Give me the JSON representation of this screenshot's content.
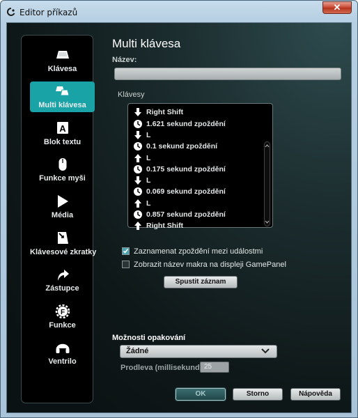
{
  "window": {
    "title": "Editor příkazů",
    "close_label": "✕"
  },
  "sidebar": {
    "items": [
      {
        "label": "Klávesa",
        "icon": "key-icon",
        "active": false
      },
      {
        "label": "Multi klávesa",
        "icon": "multi-key-icon",
        "active": true
      },
      {
        "label": "Blok textu",
        "icon": "text-block-icon",
        "active": false
      },
      {
        "label": "Funkce myši",
        "icon": "mouse-icon",
        "active": false
      },
      {
        "label": "Média",
        "icon": "play-icon",
        "active": false
      },
      {
        "label": "Klávesové zkratky",
        "icon": "shortcut-icon",
        "active": false
      },
      {
        "label": "Zástupce",
        "icon": "arrow-icon",
        "active": false
      },
      {
        "label": "Funkce",
        "icon": "gear-f-icon",
        "active": false
      },
      {
        "label": "Ventrilo",
        "icon": "headset-icon",
        "active": false
      }
    ]
  },
  "main": {
    "title": "Multi klávesa",
    "name_label": "Název:",
    "name_value": "",
    "keys_label": "Klávesy",
    "keys": [
      {
        "type": "down",
        "text": "Right Shift"
      },
      {
        "type": "delay",
        "text": "1.621 sekund zpoždění"
      },
      {
        "type": "down",
        "text": "L"
      },
      {
        "type": "delay",
        "text": "0.1 sekund zpoždění"
      },
      {
        "type": "up",
        "text": "L"
      },
      {
        "type": "delay",
        "text": "0.175 sekund zpoždění"
      },
      {
        "type": "down",
        "text": "L"
      },
      {
        "type": "delay",
        "text": "0.069 sekund zpoždění"
      },
      {
        "type": "up",
        "text": "L"
      },
      {
        "type": "delay",
        "text": "0.857 sekund zpoždění"
      },
      {
        "type": "up",
        "text": "Right Shift"
      }
    ],
    "record_delays_label": "Zaznamenat zpoždění mezi událostmi",
    "record_delays_checked": true,
    "show_name_label": "Zobrazit název makra na displeji GamePanel",
    "show_name_checked": false,
    "record_button": "Spustit záznam",
    "repeat_label": "Možnosti opakování",
    "repeat_value": "Žádné",
    "delay_label": "Prodleva (millisekund):",
    "delay_value": "25"
  },
  "footer": {
    "ok": "OK",
    "cancel": "Storno",
    "help": "Nápověda"
  },
  "colors": {
    "accent": "#19a3a7",
    "background": "#0f1819"
  }
}
